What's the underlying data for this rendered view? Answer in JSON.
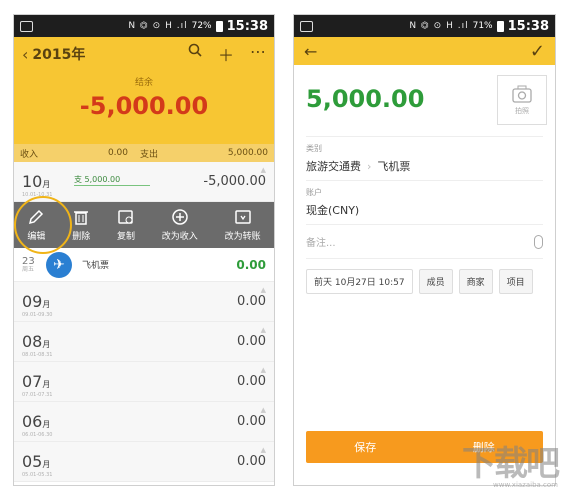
{
  "left": {
    "status": {
      "signal_icons": "N ⏣ ⊙ H .ıl",
      "battery": "72%",
      "time": "15:38"
    },
    "header": {
      "title": "2015年",
      "balance_label": "结余",
      "balance_value": "-5,000.00"
    },
    "summary": {
      "income_label": "收入",
      "income_value": "0.00",
      "expense_label": "支出",
      "expense_value": "5,000.00"
    },
    "october": {
      "month": "10",
      "unit": "月",
      "range": "10.01-10.31",
      "bar_label": "支 5,000.00",
      "amount": "-5,000.00"
    },
    "actions": [
      {
        "icon": "pencil-icon",
        "label": "编辑"
      },
      {
        "icon": "trash-icon",
        "label": "删除"
      },
      {
        "icon": "copy-icon",
        "label": "复制"
      },
      {
        "icon": "plus-circle-icon",
        "label": "改为收入"
      },
      {
        "icon": "transfer-icon",
        "label": "改为转账"
      }
    ],
    "entry": {
      "day": "23",
      "weekday": "周五",
      "icon": "plane-icon",
      "name": "飞机票",
      "amount": "0.00"
    },
    "months": [
      {
        "month": "09",
        "unit": "月",
        "range": "09.01-09.30",
        "amount": "0.00"
      },
      {
        "month": "08",
        "unit": "月",
        "range": "08.01-08.31",
        "amount": "0.00"
      },
      {
        "month": "07",
        "unit": "月",
        "range": "07.01-07.31",
        "amount": "0.00"
      },
      {
        "month": "06",
        "unit": "月",
        "range": "06.01-06.30",
        "amount": "0.00"
      },
      {
        "month": "05",
        "unit": "月",
        "range": "05.01-05.31",
        "amount": "0.00"
      }
    ]
  },
  "right": {
    "status": {
      "signal_icons": "N ⏣ ⊙ H .ıl",
      "battery": "71%",
      "time": "15:38"
    },
    "amount": "5,000.00",
    "photo_label": "拍照",
    "category": {
      "label": "类别",
      "parent": "旅游交通费",
      "child": "飞机票"
    },
    "account": {
      "label": "账户",
      "value": "现金(CNY)"
    },
    "note_placeholder": "备注...",
    "chips": {
      "date": "前天 10月27日 10:57",
      "member": "成员",
      "merchant": "商家",
      "project": "项目"
    },
    "save_label": "保存",
    "delete_label": "删除"
  },
  "watermark": {
    "logo": "下载吧",
    "url": "www.xiazaiba.com"
  },
  "colors": {
    "accent_yellow": "#f7c633",
    "expense_red": "#d33a1a",
    "income_green": "#2e9c3a",
    "save_orange": "#f79a1e"
  }
}
